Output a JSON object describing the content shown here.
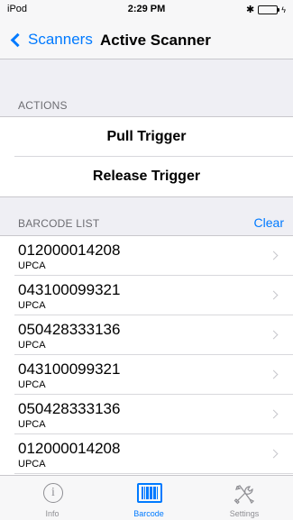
{
  "status": {
    "carrier": "iPod",
    "time": "2:29 PM",
    "bluetooth": "✱",
    "bolt": "ϟ"
  },
  "nav": {
    "back_label": "Scanners",
    "title": "Active Scanner"
  },
  "actions": {
    "header": "ACTIONS",
    "items": [
      {
        "label": "Pull Trigger"
      },
      {
        "label": "Release Trigger"
      }
    ]
  },
  "barcodes": {
    "header": "BARCODE LIST",
    "clear_label": "Clear",
    "items": [
      {
        "code": "012000014208",
        "type": "UPCA"
      },
      {
        "code": "043100099321",
        "type": "UPCA"
      },
      {
        "code": "050428333136",
        "type": "UPCA"
      },
      {
        "code": "043100099321",
        "type": "UPCA"
      },
      {
        "code": "050428333136",
        "type": "UPCA"
      },
      {
        "code": "012000014208",
        "type": "UPCA"
      }
    ]
  },
  "tabs": [
    {
      "label": "Info",
      "icon": "info-icon"
    },
    {
      "label": "Barcode",
      "icon": "barcode-icon"
    },
    {
      "label": "Settings",
      "icon": "settings-icon"
    }
  ],
  "colors": {
    "accent": "#007aff",
    "battery": "#4cd964",
    "background": "#efeff4"
  }
}
